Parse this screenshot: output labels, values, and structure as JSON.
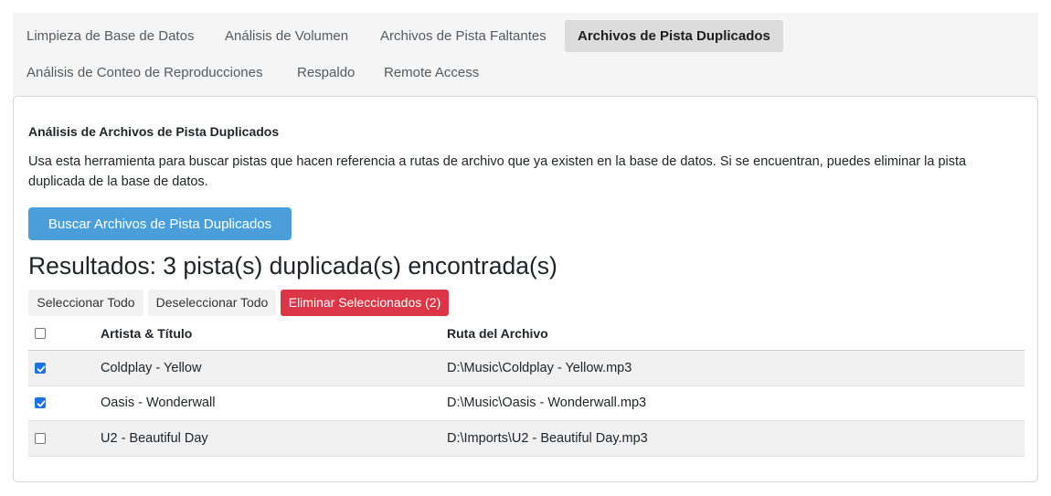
{
  "tabs": [
    {
      "label": "Limpieza de Base de Datos",
      "active": false
    },
    {
      "label": "Análisis de Volumen",
      "active": false
    },
    {
      "label": "Archivos de Pista Faltantes",
      "active": false
    },
    {
      "label": "Archivos de Pista Duplicados",
      "active": true
    },
    {
      "label": "Análisis de Conteo de Reproducciones",
      "active": false
    },
    {
      "label": "Respaldo",
      "active": false
    },
    {
      "label": "Remote Access",
      "active": false
    }
  ],
  "panel": {
    "heading": "Análisis de Archivos de Pista Duplicados",
    "description": "Usa esta herramienta para buscar pistas que hacen referencia a rutas de archivo que ya existen en la base de datos. Si se encuentran, puedes eliminar la pista duplicada de la base de datos.",
    "scan_button": "Buscar Archivos de Pista Duplicados",
    "results_title": "Resultados: 3 pista(s) duplicada(s) encontrada(s)",
    "select_all": "Seleccionar Todo",
    "deselect_all": "Deseleccionar Todo",
    "delete_selected": "Eliminar Seleccionados (2)"
  },
  "table": {
    "headers": {
      "artist_title": "Artista & Título",
      "path": "Ruta del Archivo"
    },
    "rows": [
      {
        "artist_title": "Coldplay - Yellow",
        "path": "D:\\Music\\Coldplay - Yellow.mp3",
        "checked": true
      },
      {
        "artist_title": "Oasis - Wonderwall",
        "path": "D:\\Music\\Oasis - Wonderwall.mp3",
        "checked": true
      },
      {
        "artist_title": "U2 - Beautiful Day",
        "path": "D:\\Imports\\U2 - Beautiful Day.mp3",
        "checked": false
      }
    ]
  },
  "colors": {
    "primary": "#4a9fda",
    "danger": "#dc3545",
    "checkbox": "#1a73e8",
    "active_tab": "#dcdcdc"
  }
}
